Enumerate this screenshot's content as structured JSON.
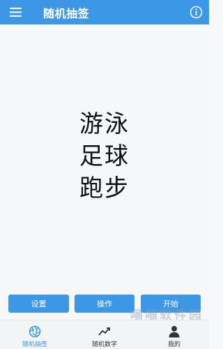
{
  "app": {
    "title": "随机抽签",
    "accent_color": "#3c98e6"
  },
  "header": {
    "menu_icon": "hamburger-menu-icon",
    "info_icon": "info-icon"
  },
  "result": {
    "lines": [
      "游泳",
      "足球",
      "跑步"
    ]
  },
  "actions": {
    "settings_label": "设置",
    "operate_label": "操作",
    "start_label": "开始"
  },
  "bottom_nav": {
    "items": [
      {
        "label": "随机抽签",
        "icon": "aperture-icon",
        "active": true
      },
      {
        "label": "随机数字",
        "icon": "trend-line-icon",
        "active": false
      },
      {
        "label": "我的",
        "icon": "person-icon",
        "active": false
      }
    ]
  },
  "watermark": {
    "title": "嘀嘀软件园",
    "url": "www.ddlsoft.com"
  }
}
